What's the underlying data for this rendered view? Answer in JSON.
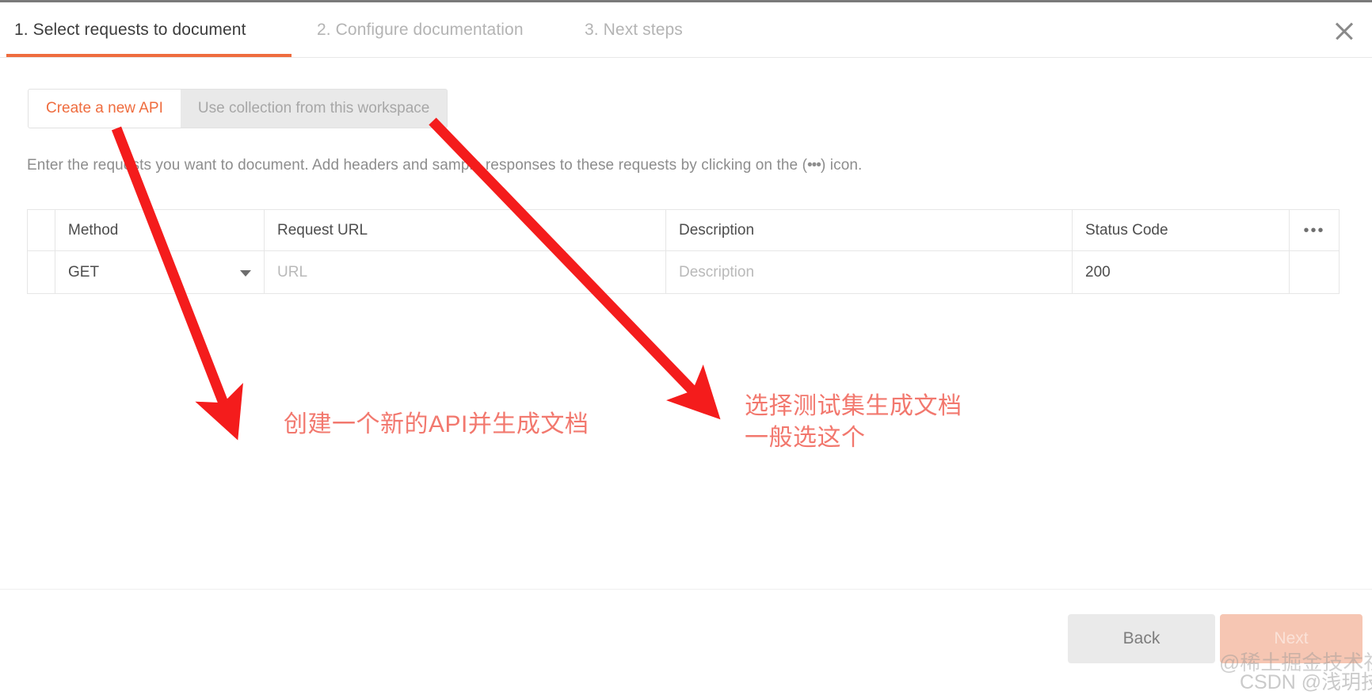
{
  "window": {
    "close_icon": "close-icon"
  },
  "wizard": {
    "tabs": [
      {
        "label": "1. Select requests to document",
        "active": true
      },
      {
        "label": "2. Configure documentation",
        "active": false
      },
      {
        "label": "3. Next steps",
        "active": false
      }
    ],
    "active_accent_color": "#ef6c3e"
  },
  "source_selector": {
    "options": [
      {
        "label": "Create a new API",
        "selected": true
      },
      {
        "label": "Use collection from this workspace",
        "selected": false
      }
    ]
  },
  "helper": {
    "text_before": "Enter the requests you want to document. Add headers and sample responses to these requests by clicking on the (",
    "dots": "•••",
    "text_after": ") icon."
  },
  "requests_table": {
    "columns": [
      "",
      "Method",
      "Request URL",
      "Description",
      "Status Code",
      "•••"
    ],
    "headers": {
      "handle": "",
      "method": "Method",
      "url": "Request URL",
      "description": "Description",
      "status": "Status Code",
      "more": "•••"
    },
    "rows": [
      {
        "method_value": "GET",
        "url_placeholder": "URL",
        "description_placeholder": "Description",
        "status_value": "200",
        "more": ""
      }
    ],
    "method_caret_icon": "chevron-down-icon"
  },
  "annotations": {
    "color": "#f2786e",
    "arrow_color": "#f41c1c",
    "notes": [
      {
        "text": "创建一个新的API并生成文档"
      },
      {
        "text": "选择测试集生成文档\n一般选这个"
      }
    ]
  },
  "footer": {
    "back_label": "Back",
    "next_label": "Next"
  },
  "watermarks": [
    {
      "text": "@稀土掘金技术社区"
    },
    {
      "text": "CSDN @浅玥技术"
    }
  ]
}
